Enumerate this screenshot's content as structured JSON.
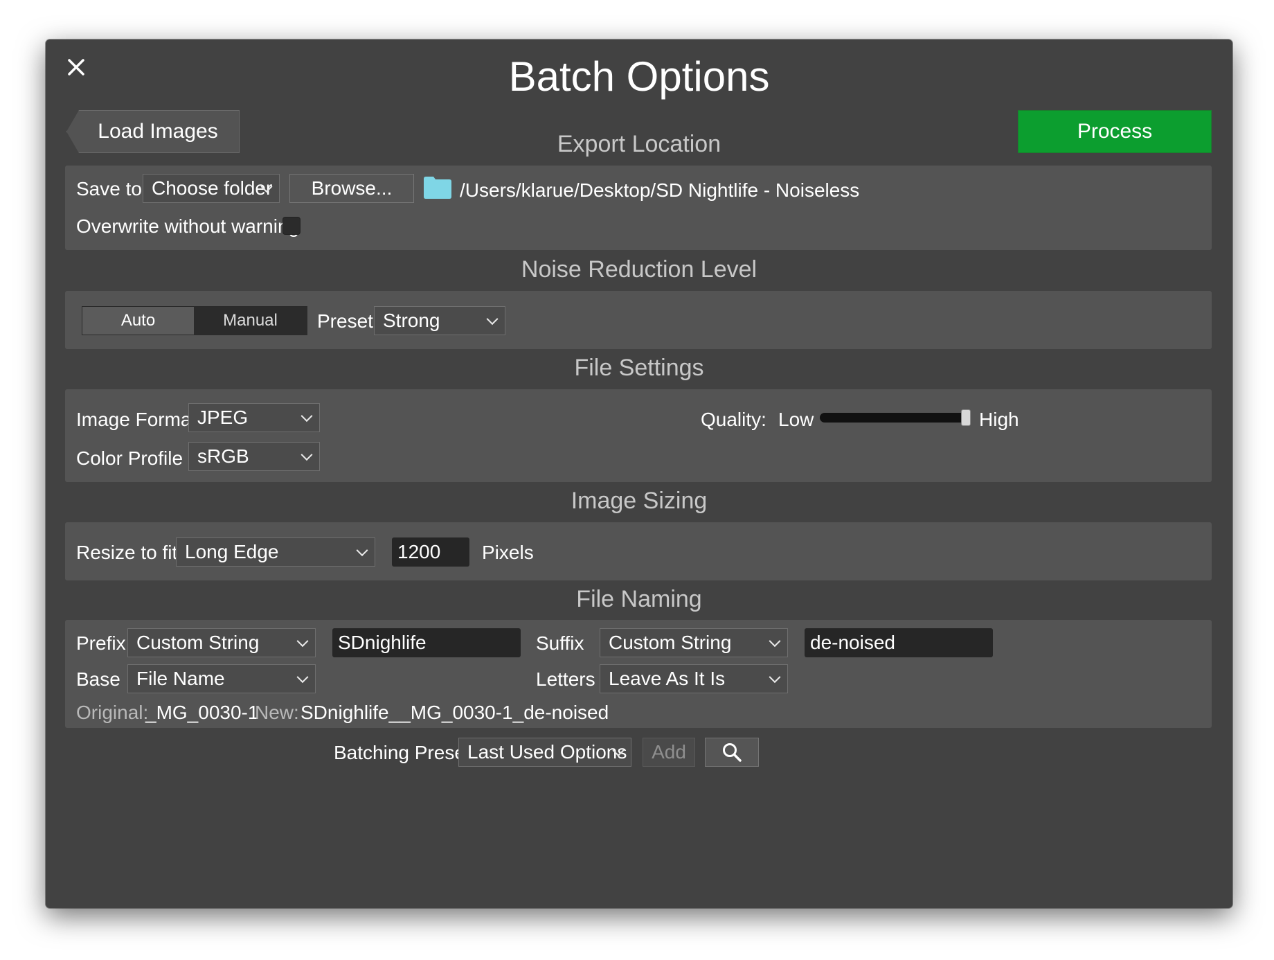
{
  "window": {
    "title": "Batch Options"
  },
  "toolbar": {
    "load_label": "Load Images",
    "process_label": "Process"
  },
  "export_location": {
    "heading": "Export Location",
    "save_to_label": "Save to",
    "destination_value": "Choose folder",
    "browse_label": "Browse...",
    "path": "/Users/klarue/Desktop/SD Nightlife - Noiseless",
    "overwrite_label": "Overwrite without warning",
    "overwrite_checked": false
  },
  "noise_reduction": {
    "heading": "Noise Reduction Level",
    "modes": [
      "Auto",
      "Manual"
    ],
    "selected_mode": "Manual",
    "preset_label": "Preset",
    "preset_value": "Strong"
  },
  "file_settings": {
    "heading": "File Settings",
    "format_label": "Image Format",
    "format_value": "JPEG",
    "profile_label": "Color Profile",
    "profile_value": "sRGB",
    "quality_label": "Quality:",
    "quality_low": "Low",
    "quality_high": "High",
    "quality_level": 1.0
  },
  "image_sizing": {
    "heading": "Image Sizing",
    "resize_label": "Resize to fit",
    "resize_value": "Long Edge",
    "size_value": "1200",
    "unit_label": "Pixels"
  },
  "file_naming": {
    "heading": "File Naming",
    "prefix_label": "Prefix",
    "prefix_type": "Custom String",
    "prefix_value": "SDnighlife",
    "suffix_label": "Suffix",
    "suffix_type": "Custom String",
    "suffix_value": "de-noised",
    "base_label": "Base",
    "base_value": "File Name",
    "letters_label": "Letters",
    "letters_value": "Leave As It Is",
    "original_label": "Original:",
    "original_value": "_MG_0030-1",
    "new_label": "New:",
    "new_value": "SDnighlife__MG_0030-1_de-noised"
  },
  "footer": {
    "preset_label": "Batching Preset",
    "preset_value": "Last Used Options",
    "add_label": "Add"
  },
  "colors": {
    "dialog_bg": "#424242",
    "panel_bg": "#545454",
    "process_green": "#0c9e2f",
    "folder_icon": "#7fd6e6"
  },
  "icons": [
    "close-icon",
    "folder-icon",
    "chevron-down-icon",
    "search-icon"
  ]
}
